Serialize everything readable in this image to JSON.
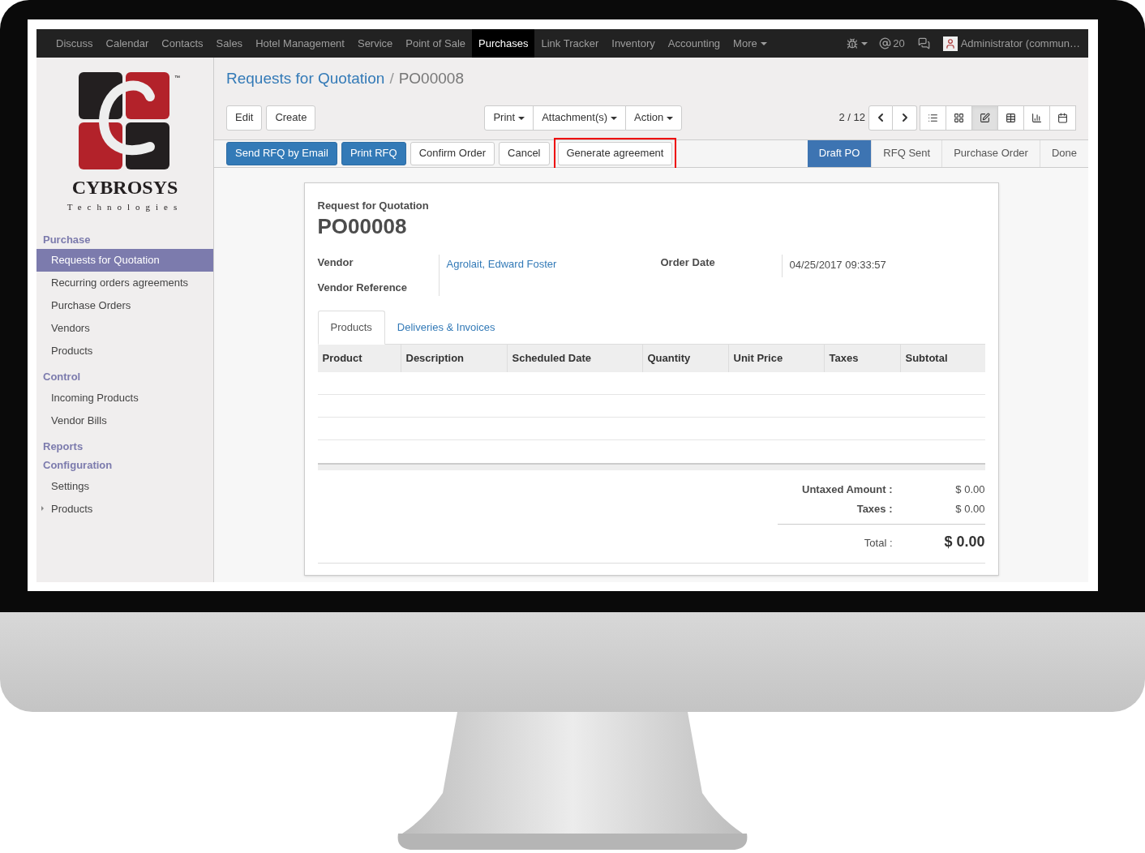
{
  "navbar": {
    "menus": [
      {
        "label": "Discuss",
        "selected": false
      },
      {
        "label": "Calendar",
        "selected": false
      },
      {
        "label": "Contacts",
        "selected": false
      },
      {
        "label": "Sales",
        "selected": false
      },
      {
        "label": "Hotel Management",
        "selected": false
      },
      {
        "label": "Service",
        "selected": false
      },
      {
        "label": "Point of Sale",
        "selected": false
      },
      {
        "label": "Purchases",
        "selected": true
      },
      {
        "label": "Link Tracker",
        "selected": false
      },
      {
        "label": "Inventory",
        "selected": false
      },
      {
        "label": "Accounting",
        "selected": false
      },
      {
        "label": "More",
        "selected": false
      }
    ],
    "mentions": "20",
    "user": "Administrator (commun…"
  },
  "logo": {
    "name": "CYBROSYS",
    "tagline": "Technologies",
    "mark": "™"
  },
  "sidebar": {
    "sections": [
      {
        "title": "Purchase",
        "items": [
          {
            "label": "Requests for Quotation",
            "selected": true,
            "expandable": false
          },
          {
            "label": "Recurring orders agreements",
            "selected": false,
            "expandable": false
          },
          {
            "label": "Purchase Orders",
            "selected": false,
            "expandable": false
          },
          {
            "label": "Vendors",
            "selected": false,
            "expandable": false
          },
          {
            "label": "Products",
            "selected": false,
            "expandable": false
          }
        ]
      },
      {
        "title": "Control",
        "items": [
          {
            "label": "Incoming Products",
            "selected": false,
            "expandable": false
          },
          {
            "label": "Vendor Bills",
            "selected": false,
            "expandable": false
          }
        ]
      },
      {
        "title": "Reports"
      },
      {
        "title": "Configuration",
        "items": [
          {
            "label": "Settings",
            "selected": false,
            "expandable": false
          },
          {
            "label": "Products",
            "selected": false,
            "expandable": true
          }
        ]
      }
    ]
  },
  "breadcrumb": {
    "parent": "Requests for Quotation",
    "separator": "/",
    "current": "PO00008"
  },
  "toolbar": {
    "left": [
      "Edit",
      "Create"
    ],
    "menus": [
      "Print",
      "Attachment(s)",
      "Action"
    ],
    "pager": "2 / 12",
    "views": [
      {
        "kind": "list",
        "selected": false
      },
      {
        "kind": "kanban",
        "selected": false
      },
      {
        "kind": "form",
        "selected": true
      },
      {
        "kind": "grid",
        "selected": false
      },
      {
        "kind": "graph",
        "selected": false
      },
      {
        "kind": "calendar",
        "selected": false
      }
    ]
  },
  "statusbar": {
    "buttons": [
      {
        "label": "Send RFQ by Email",
        "primary": true,
        "highlighted": false
      },
      {
        "label": "Print RFQ",
        "primary": true,
        "highlighted": false
      },
      {
        "label": "Confirm Order",
        "primary": false,
        "highlighted": false
      },
      {
        "label": "Cancel",
        "primary": false,
        "highlighted": false
      },
      {
        "label": "Generate agreement",
        "primary": false,
        "highlighted": true
      }
    ],
    "stages": [
      {
        "label": "Draft PO",
        "selected": true
      },
      {
        "label": "RFQ Sent",
        "selected": false
      },
      {
        "label": "Purchase Order",
        "selected": false
      },
      {
        "label": "Done",
        "selected": false
      }
    ]
  },
  "sheet": {
    "subtitle": "Request for Quotation",
    "name": "PO00008",
    "vendor_label": "Vendor",
    "vendor": "Agrolait, Edward Foster",
    "vendor_reference_label": "Vendor Reference",
    "order_date_label": "Order Date",
    "order_date": "04/25/2017 09:33:57",
    "tabs": [
      {
        "label": "Products",
        "selected": true
      },
      {
        "label": "Deliveries & Invoices",
        "selected": false
      }
    ],
    "columns": [
      "Product",
      "Description",
      "Scheduled Date",
      "Quantity",
      "Unit Price",
      "Taxes",
      "Subtotal"
    ],
    "totals": [
      {
        "label": "Untaxed Amount :",
        "value": "$ 0.00",
        "kind": "line"
      },
      {
        "label": "Taxes :",
        "value": "$ 0.00",
        "kind": "line"
      },
      {
        "label": "Total :",
        "value": "$ 0.00",
        "kind": "grand"
      }
    ]
  }
}
